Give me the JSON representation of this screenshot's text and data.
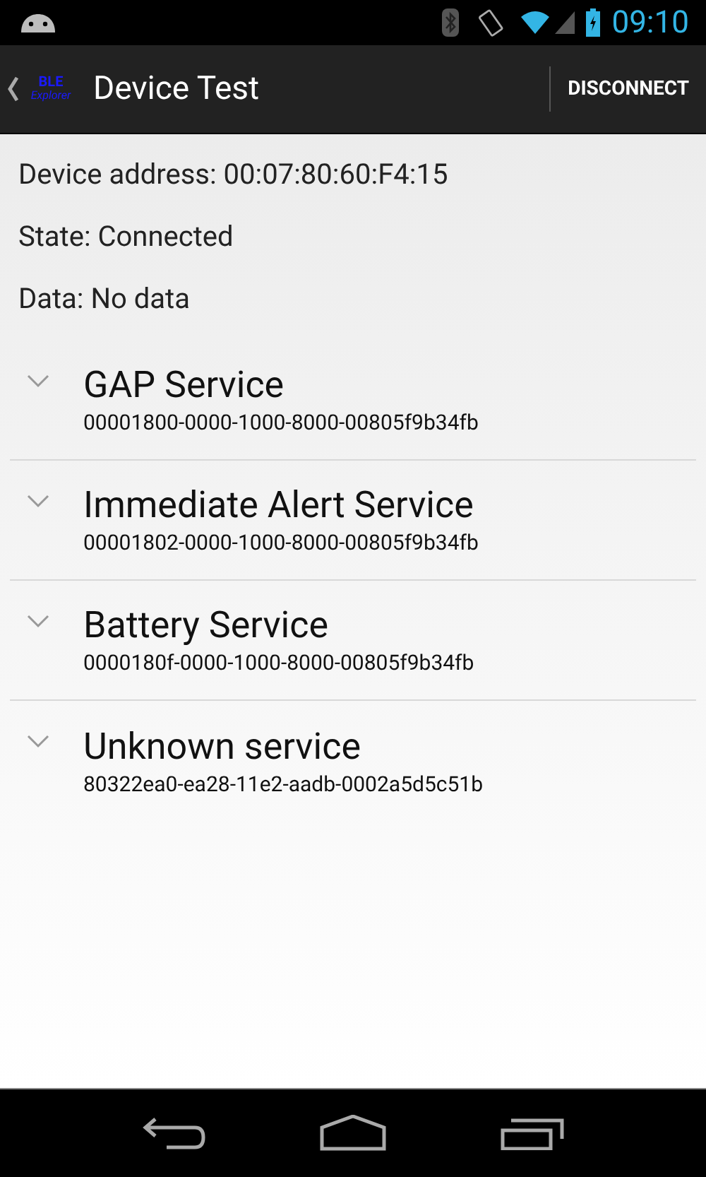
{
  "status_bar": {
    "time": "09:10"
  },
  "action_bar": {
    "logo_top": "BLE",
    "logo_bottom": "Explorer",
    "title": "Device Test",
    "action": "DISCONNECT"
  },
  "info": [
    "Device address: 00:07:80:60:F4:15",
    "State: Connected",
    "Data: No data"
  ],
  "services": [
    {
      "name": "GAP Service",
      "uuid": "00001800-0000-1000-8000-00805f9b34fb",
      "expanded": false
    },
    {
      "name": "Immediate Alert Service",
      "uuid": "00001802-0000-1000-8000-00805f9b34fb",
      "expanded": false
    },
    {
      "name": "Battery Service",
      "uuid": "0000180f-0000-1000-8000-00805f9b34fb",
      "expanded": false
    },
    {
      "name": "Unknown service",
      "uuid": "80322ea0-ea28-11e2-aadb-0002a5d5c51b",
      "expanded": false
    }
  ]
}
